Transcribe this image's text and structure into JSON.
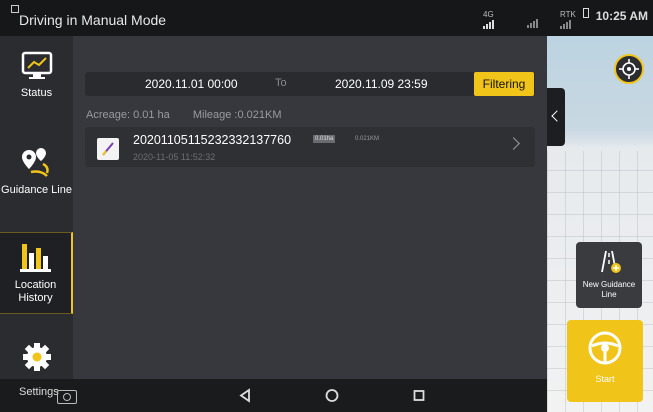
{
  "statusbar": {
    "title": "Driving in Manual Mode",
    "net_label": "4G",
    "rtk_label": "RTK",
    "time": "10:25 AM"
  },
  "sidebar": {
    "items": [
      {
        "label": "Status",
        "icon": "chart-line-icon"
      },
      {
        "label": "Guidance Line",
        "icon": "route-pin-icon"
      },
      {
        "label": "Location History",
        "icon": "bar-chart-icon",
        "active": true
      },
      {
        "label": "Settings",
        "icon": "gear-icon"
      }
    ]
  },
  "filter": {
    "start_date": "2020.11.01 00:00",
    "to_label": "To",
    "end_date": "2020.11.09 23:59",
    "button_label": "Filtering"
  },
  "summary": {
    "acreage": "Acreage: 0.01 ha",
    "mileage": "Mileage :0.021KM"
  },
  "records": [
    {
      "name": "20201105115232332137760",
      "date": "2020-11-05 11:52:32",
      "area_tag": "0.01ha",
      "distance_tag": "0.021KM"
    }
  ],
  "rightpanel": {
    "new_guidance_label": "New Guidance Line",
    "start_label": "Start"
  },
  "colors": {
    "accent": "#f0c419",
    "background": "#37383d",
    "sidebar": "#2b2c30"
  }
}
